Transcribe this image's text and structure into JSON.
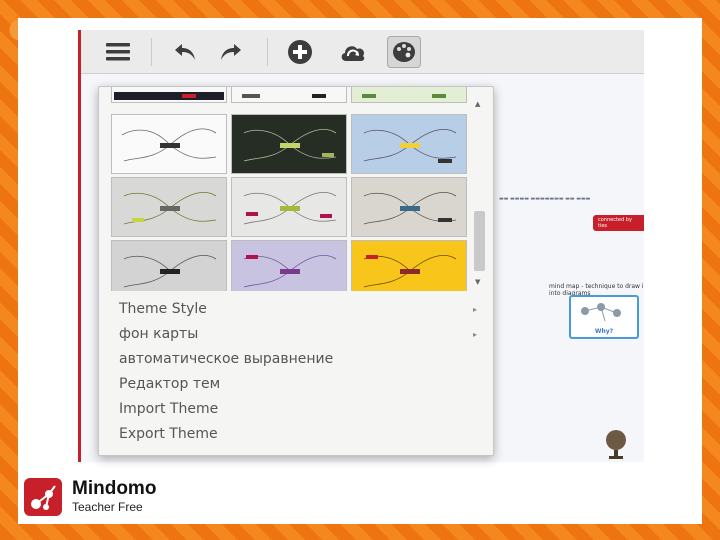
{
  "toolbar": {
    "buttons": [
      {
        "icon": "hamburger-menu-icon"
      },
      {
        "icon": "undo-icon"
      },
      {
        "icon": "redo-icon"
      },
      {
        "icon": "add-circle-icon"
      },
      {
        "icon": "cloud-sync-icon"
      },
      {
        "icon": "palette-icon",
        "active": true
      }
    ]
  },
  "theme_menu": {
    "items": [
      {
        "label": "Theme Style",
        "submenu": true
      },
      {
        "label": "фон карты",
        "submenu": true
      },
      {
        "label": "автоматическое выравнение",
        "submenu": false
      },
      {
        "label": "Редактор тем",
        "submenu": false
      },
      {
        "label": "Import Theme",
        "submenu": false
      },
      {
        "label": "Export Theme",
        "submenu": false
      }
    ],
    "submenu_arrow": "▸",
    "scroll_up": "▲",
    "scroll_down": "▼"
  },
  "background_map": {
    "badge": "connected by ties",
    "node_label": "Why?",
    "caption": "mind map - technique to draw in into diagrams"
  },
  "brand": {
    "name": "Mindomo",
    "subtitle": "Teacher Free"
  },
  "colors": {
    "accent_red": "#c8202a",
    "orange_bg": "#f07a18"
  }
}
